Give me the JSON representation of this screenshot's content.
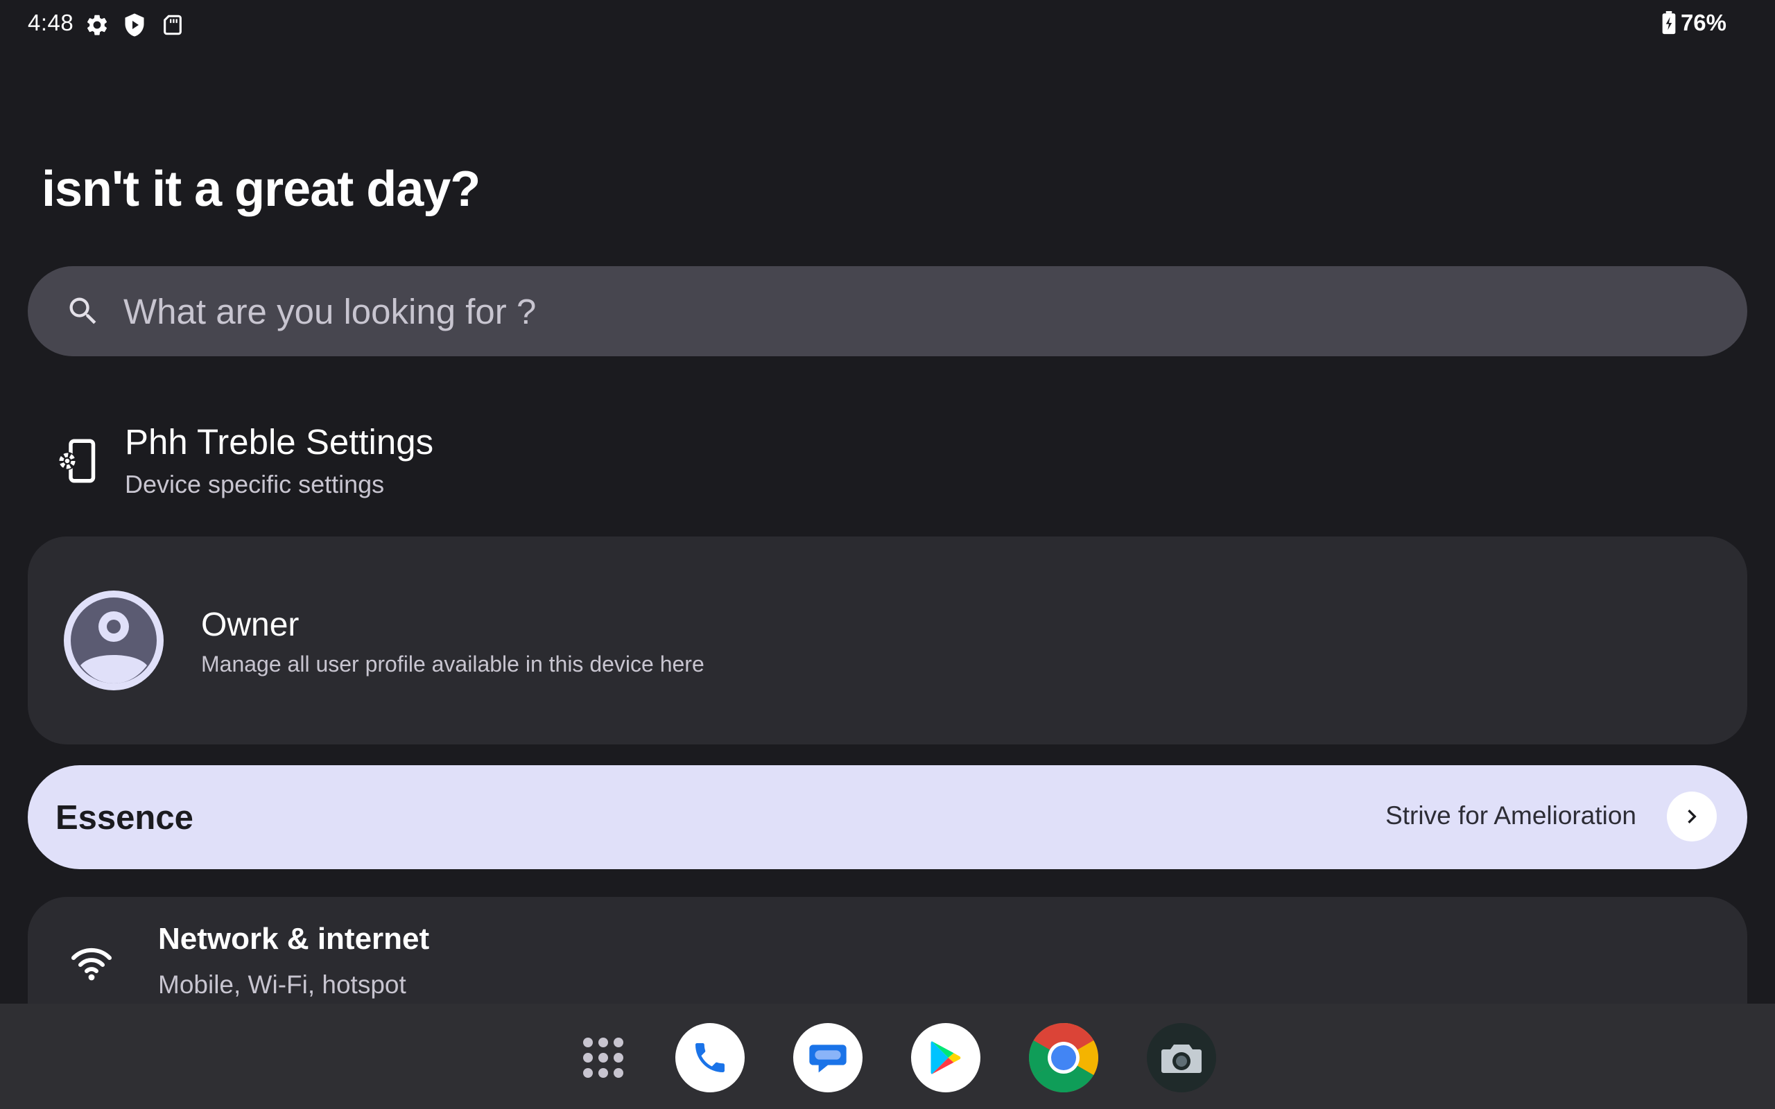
{
  "status_bar": {
    "time": "4:48",
    "icons": [
      "gear-icon",
      "shield-play-icon",
      "sd-card-icon"
    ],
    "battery": "76%",
    "battery_icon": "battery-charging-icon"
  },
  "greeting": "isn't it a great day?",
  "search": {
    "placeholder": "What are you looking for ?",
    "icon": "search-icon"
  },
  "phh": {
    "title": "Phh Treble Settings",
    "subtitle": "Device specific settings",
    "icon": "phone-settings-icon"
  },
  "owner": {
    "name": "Owner",
    "description": "Manage all user profile available in this device here",
    "icon": "account-circle-icon"
  },
  "essence": {
    "title": "Essence",
    "tagline": "Strive for Amelioration",
    "icon": "chevron-right-icon"
  },
  "network": {
    "title": "Network & internet",
    "subtitle": "Mobile, Wi-Fi, hotspot",
    "icon": "wifi-icon"
  },
  "taskbar": {
    "apps": [
      "app-drawer-icon",
      "phone-app-icon",
      "messages-app-icon",
      "play-store-app-icon",
      "chrome-app-icon",
      "camera-app-icon"
    ]
  },
  "colors": {
    "background": "#1b1b1f",
    "card": "#2b2b30",
    "search": "#47464f",
    "accent_banner": "#e0e0f9",
    "taskbar": "#2f2f33"
  }
}
